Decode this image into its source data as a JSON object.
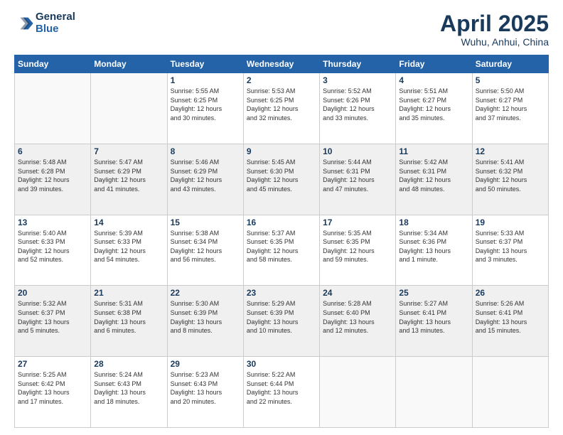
{
  "header": {
    "logo_line1": "General",
    "logo_line2": "Blue",
    "month": "April 2025",
    "location": "Wuhu, Anhui, China"
  },
  "weekdays": [
    "Sunday",
    "Monday",
    "Tuesday",
    "Wednesday",
    "Thursday",
    "Friday",
    "Saturday"
  ],
  "weeks": [
    [
      {
        "day": "",
        "info": ""
      },
      {
        "day": "",
        "info": ""
      },
      {
        "day": "1",
        "info": "Sunrise: 5:55 AM\nSunset: 6:25 PM\nDaylight: 12 hours\nand 30 minutes."
      },
      {
        "day": "2",
        "info": "Sunrise: 5:53 AM\nSunset: 6:25 PM\nDaylight: 12 hours\nand 32 minutes."
      },
      {
        "day": "3",
        "info": "Sunrise: 5:52 AM\nSunset: 6:26 PM\nDaylight: 12 hours\nand 33 minutes."
      },
      {
        "day": "4",
        "info": "Sunrise: 5:51 AM\nSunset: 6:27 PM\nDaylight: 12 hours\nand 35 minutes."
      },
      {
        "day": "5",
        "info": "Sunrise: 5:50 AM\nSunset: 6:27 PM\nDaylight: 12 hours\nand 37 minutes."
      }
    ],
    [
      {
        "day": "6",
        "info": "Sunrise: 5:48 AM\nSunset: 6:28 PM\nDaylight: 12 hours\nand 39 minutes."
      },
      {
        "day": "7",
        "info": "Sunrise: 5:47 AM\nSunset: 6:29 PM\nDaylight: 12 hours\nand 41 minutes."
      },
      {
        "day": "8",
        "info": "Sunrise: 5:46 AM\nSunset: 6:29 PM\nDaylight: 12 hours\nand 43 minutes."
      },
      {
        "day": "9",
        "info": "Sunrise: 5:45 AM\nSunset: 6:30 PM\nDaylight: 12 hours\nand 45 minutes."
      },
      {
        "day": "10",
        "info": "Sunrise: 5:44 AM\nSunset: 6:31 PM\nDaylight: 12 hours\nand 47 minutes."
      },
      {
        "day": "11",
        "info": "Sunrise: 5:42 AM\nSunset: 6:31 PM\nDaylight: 12 hours\nand 48 minutes."
      },
      {
        "day": "12",
        "info": "Sunrise: 5:41 AM\nSunset: 6:32 PM\nDaylight: 12 hours\nand 50 minutes."
      }
    ],
    [
      {
        "day": "13",
        "info": "Sunrise: 5:40 AM\nSunset: 6:33 PM\nDaylight: 12 hours\nand 52 minutes."
      },
      {
        "day": "14",
        "info": "Sunrise: 5:39 AM\nSunset: 6:33 PM\nDaylight: 12 hours\nand 54 minutes."
      },
      {
        "day": "15",
        "info": "Sunrise: 5:38 AM\nSunset: 6:34 PM\nDaylight: 12 hours\nand 56 minutes."
      },
      {
        "day": "16",
        "info": "Sunrise: 5:37 AM\nSunset: 6:35 PM\nDaylight: 12 hours\nand 58 minutes."
      },
      {
        "day": "17",
        "info": "Sunrise: 5:35 AM\nSunset: 6:35 PM\nDaylight: 12 hours\nand 59 minutes."
      },
      {
        "day": "18",
        "info": "Sunrise: 5:34 AM\nSunset: 6:36 PM\nDaylight: 13 hours\nand 1 minute."
      },
      {
        "day": "19",
        "info": "Sunrise: 5:33 AM\nSunset: 6:37 PM\nDaylight: 13 hours\nand 3 minutes."
      }
    ],
    [
      {
        "day": "20",
        "info": "Sunrise: 5:32 AM\nSunset: 6:37 PM\nDaylight: 13 hours\nand 5 minutes."
      },
      {
        "day": "21",
        "info": "Sunrise: 5:31 AM\nSunset: 6:38 PM\nDaylight: 13 hours\nand 6 minutes."
      },
      {
        "day": "22",
        "info": "Sunrise: 5:30 AM\nSunset: 6:39 PM\nDaylight: 13 hours\nand 8 minutes."
      },
      {
        "day": "23",
        "info": "Sunrise: 5:29 AM\nSunset: 6:39 PM\nDaylight: 13 hours\nand 10 minutes."
      },
      {
        "day": "24",
        "info": "Sunrise: 5:28 AM\nSunset: 6:40 PM\nDaylight: 13 hours\nand 12 minutes."
      },
      {
        "day": "25",
        "info": "Sunrise: 5:27 AM\nSunset: 6:41 PM\nDaylight: 13 hours\nand 13 minutes."
      },
      {
        "day": "26",
        "info": "Sunrise: 5:26 AM\nSunset: 6:41 PM\nDaylight: 13 hours\nand 15 minutes."
      }
    ],
    [
      {
        "day": "27",
        "info": "Sunrise: 5:25 AM\nSunset: 6:42 PM\nDaylight: 13 hours\nand 17 minutes."
      },
      {
        "day": "28",
        "info": "Sunrise: 5:24 AM\nSunset: 6:43 PM\nDaylight: 13 hours\nand 18 minutes."
      },
      {
        "day": "29",
        "info": "Sunrise: 5:23 AM\nSunset: 6:43 PM\nDaylight: 13 hours\nand 20 minutes."
      },
      {
        "day": "30",
        "info": "Sunrise: 5:22 AM\nSunset: 6:44 PM\nDaylight: 13 hours\nand 22 minutes."
      },
      {
        "day": "",
        "info": ""
      },
      {
        "day": "",
        "info": ""
      },
      {
        "day": "",
        "info": ""
      }
    ]
  ]
}
